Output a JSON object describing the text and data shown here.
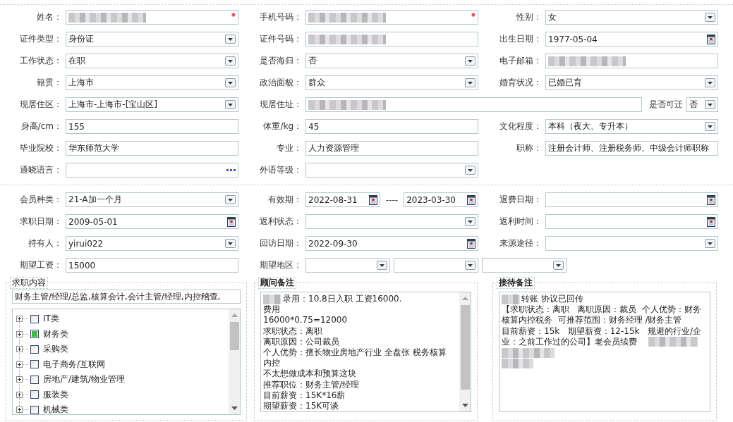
{
  "sections": [
    {
      "rows": [
        [
          {
            "label": "姓名：",
            "controls": [
              {
                "kind": "text",
                "redacted": true,
                "required": true
              }
            ]
          },
          {
            "label": "手机号码：",
            "controls": [
              {
                "kind": "text",
                "redacted": true,
                "required": true
              }
            ]
          },
          {
            "label": "性别：",
            "controls": [
              {
                "kind": "select",
                "value": "女"
              }
            ]
          }
        ],
        [
          {
            "label": "证件类型：",
            "controls": [
              {
                "kind": "select",
                "value": "身份证"
              }
            ]
          },
          {
            "label": "证件号码：",
            "controls": [
              {
                "kind": "text",
                "redacted": true
              }
            ]
          },
          {
            "label": "出生日期：",
            "controls": [
              {
                "kind": "date",
                "value": "1977-05-04"
              }
            ]
          }
        ],
        [
          {
            "label": "工作状态：",
            "controls": [
              {
                "kind": "select",
                "value": "在职"
              }
            ]
          },
          {
            "label": "是否海归：",
            "controls": [
              {
                "kind": "select",
                "value": "否"
              }
            ]
          },
          {
            "label": "电子邮箱：",
            "controls": [
              {
                "kind": "text",
                "redacted": true
              }
            ]
          }
        ],
        [
          {
            "label": "籍贯：",
            "controls": [
              {
                "kind": "select",
                "value": "上海市"
              }
            ]
          },
          {
            "label": "政治面貌：",
            "controls": [
              {
                "kind": "select",
                "value": "群众"
              }
            ]
          },
          {
            "label": "婚育状况：",
            "controls": [
              {
                "kind": "select",
                "value": "已婚已育"
              }
            ]
          }
        ],
        [
          {
            "label": "现居住区：",
            "controls": [
              {
                "kind": "select",
                "value": "上海市-上海市-[宝山区]"
              }
            ]
          },
          {
            "label": "现居住址：",
            "wide": true,
            "controls": [
              {
                "kind": "text",
                "redacted": true
              },
              {
                "kind": "label",
                "value": "是否可迁"
              },
              {
                "kind": "select",
                "value": "否"
              }
            ]
          }
        ],
        [
          {
            "label": "身高/cm：",
            "controls": [
              {
                "kind": "text",
                "value": "155"
              }
            ]
          },
          {
            "label": "体重/kg：",
            "controls": [
              {
                "kind": "text",
                "value": "45"
              }
            ]
          },
          {
            "label": "文化程度：",
            "controls": [
              {
                "kind": "select",
                "value": "本科（夜大、专升本）"
              }
            ]
          }
        ],
        [
          {
            "label": "毕业院校：",
            "controls": [
              {
                "kind": "text",
                "value": "华东师范大学"
              }
            ]
          },
          {
            "label": "专业：",
            "controls": [
              {
                "kind": "text",
                "value": "人力资源管理"
              }
            ]
          },
          {
            "label": "职称：",
            "controls": [
              {
                "kind": "text",
                "value": "注册会计师、注册税务师、中级会计师职称"
              }
            ]
          }
        ],
        [
          {
            "label": "通晓语言：",
            "controls": [
              {
                "kind": "lookup"
              }
            ]
          },
          {
            "label": "外语等级：",
            "controls": [
              {
                "kind": "select"
              }
            ]
          }
        ]
      ]
    },
    {
      "rows": [
        [
          {
            "label": "会员种类：",
            "controls": [
              {
                "kind": "select",
                "value": "21-A加一个月"
              }
            ]
          },
          {
            "label": "有效期：",
            "controls": [
              {
                "kind": "date",
                "value": "2022-08-31"
              },
              {
                "kind": "separator",
                "value": "----"
              },
              {
                "kind": "date",
                "value": "2023-03-30"
              }
            ]
          },
          {
            "label": "退费日期：",
            "controls": [
              {
                "kind": "date"
              }
            ]
          }
        ],
        [
          {
            "label": "求职日期：",
            "controls": [
              {
                "kind": "date",
                "value": "2009-05-01"
              }
            ]
          },
          {
            "label": "返利状态：",
            "controls": [
              {
                "kind": "select"
              }
            ]
          },
          {
            "label": "返利时间：",
            "controls": [
              {
                "kind": "date"
              }
            ]
          }
        ],
        [
          {
            "label": "持有人：",
            "controls": [
              {
                "kind": "select",
                "value": "yirui022"
              }
            ]
          },
          {
            "label": "回访日期：",
            "controls": [
              {
                "kind": "date",
                "value": "2022-09-30"
              }
            ]
          },
          {
            "label": "来源途径：",
            "controls": [
              {
                "kind": "select"
              }
            ]
          }
        ],
        [
          {
            "label": "期望工资：",
            "controls": [
              {
                "kind": "text",
                "value": "15000"
              }
            ]
          },
          {
            "label": "期望地区：",
            "wide": true,
            "controls": [
              {
                "kind": "select"
              },
              {
                "kind": "select"
              },
              {
                "kind": "select"
              }
            ]
          }
        ]
      ]
    }
  ],
  "panels": [
    {
      "kind": "tree",
      "legend": "求职内容",
      "emphasis": false,
      "summary": "财务主管/经理/总监,核算会计,会计主管/经理,内控稽查,",
      "categories": [
        {
          "label": "IT类",
          "checked": false,
          "expanded": false
        },
        {
          "label": "财务类",
          "checked": true,
          "expanded": false
        },
        {
          "label": "采购类",
          "checked": false,
          "expanded": false
        },
        {
          "label": "电子商务/互联网",
          "checked": false,
          "expanded": false
        },
        {
          "label": "房地产/建筑/物业管理",
          "checked": false,
          "expanded": false
        },
        {
          "label": "服装类",
          "checked": false,
          "expanded": false
        },
        {
          "label": "机械类",
          "checked": false,
          "expanded": false
        }
      ]
    },
    {
      "kind": "notes",
      "legend": "顾问备注",
      "emphasis": true,
      "scrollable": true,
      "lines": [
        {
          "kind": "text",
          "text": "录用：10.8日入职 工资16000.",
          "redacted_before": true
        },
        {
          "kind": "text",
          "text": "费用"
        },
        {
          "kind": "text",
          "text": "16000*0.75=12000"
        },
        {
          "kind": "text",
          "text": "求职状态：离职"
        },
        {
          "kind": "text",
          "text": "离职原因：公司裁员"
        },
        {
          "kind": "text",
          "text": "个人优势：擅长物业房地产行业 全盘张 税务核算"
        },
        {
          "kind": "text",
          "text": "内控"
        },
        {
          "kind": "text",
          "text": "不太想做成本和预算这块"
        },
        {
          "kind": "text",
          "text": "推荐职位：财务主管/经理"
        },
        {
          "kind": "text",
          "text": "目前薪资：15K*16薪"
        },
        {
          "kind": "text",
          "text": "期望薪资：15K可谈"
        }
      ]
    },
    {
      "kind": "notes",
      "legend": "接待备注",
      "emphasis": true,
      "scrollable": false,
      "lines": [
        {
          "kind": "text",
          "text": "转账 协议已回传",
          "redacted_before": true
        },
        {
          "kind": "text",
          "text": "【求职状态：离职   离职原因：裁员  个人优势：财务"
        },
        {
          "kind": "text",
          "text": "核算内控税务  可推荐范围：财务经理 /财务主管"
        },
        {
          "kind": "text",
          "text": "目前薪资：15k   期望薪资：12-15k   规避的行业/企"
        },
        {
          "kind": "text",
          "text": "业：之前工作过的公司】老会员续费",
          "redacted_after": true
        },
        {
          "kind": "redacted"
        },
        {
          "kind": "redacted"
        }
      ]
    }
  ]
}
